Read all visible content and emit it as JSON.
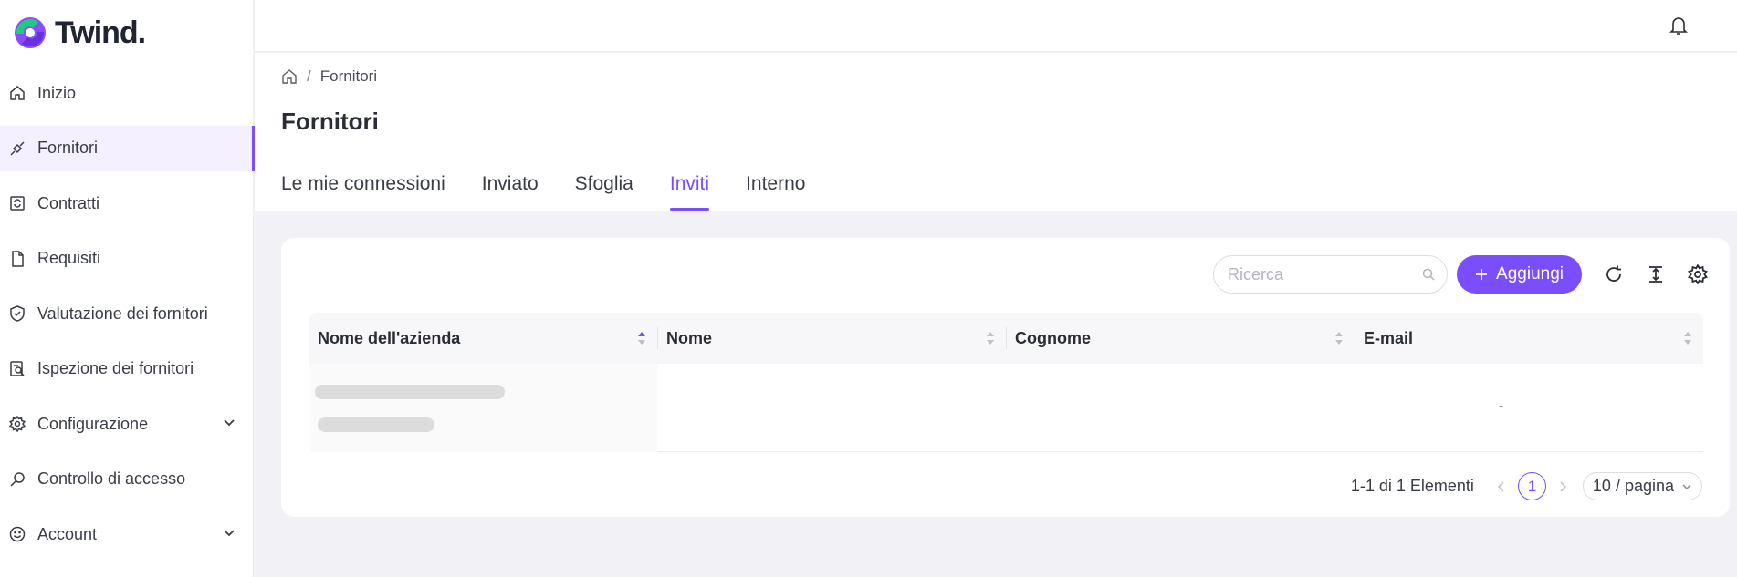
{
  "brand": {
    "name": "Twind."
  },
  "sidebar": {
    "items": [
      {
        "label": "Inizio",
        "icon": "home-icon"
      },
      {
        "label": "Fornitori",
        "icon": "link-icon",
        "active": true
      },
      {
        "label": "Contratti",
        "icon": "contract-icon"
      },
      {
        "label": "Requisiti",
        "icon": "document-icon"
      },
      {
        "label": "Valutazione dei fornitori",
        "icon": "shield-check-icon"
      },
      {
        "label": "Ispezione dei fornitori",
        "icon": "inspection-icon"
      },
      {
        "label": "Configurazione",
        "icon": "gear-icon",
        "expandable": true
      },
      {
        "label": "Controllo di accesso",
        "icon": "key-icon"
      },
      {
        "label": "Account",
        "icon": "smiley-icon",
        "expandable": true
      }
    ]
  },
  "breadcrumb": {
    "current": "Fornitori"
  },
  "page": {
    "title": "Fornitori"
  },
  "tabs": [
    {
      "label": "Le mie connessioni"
    },
    {
      "label": "Inviato"
    },
    {
      "label": "Sfoglia"
    },
    {
      "label": "Inviti",
      "active": true
    },
    {
      "label": "Interno"
    }
  ],
  "toolbar": {
    "search_placeholder": "Ricerca",
    "add_label": "Aggiungi"
  },
  "table": {
    "columns": [
      "Nome dell'azienda",
      "Nome",
      "Cognome",
      "E-mail"
    ],
    "rows": [
      {
        "email": "-"
      }
    ]
  },
  "pagination": {
    "total": "1-1 di 1 Elementi",
    "current_page": "1",
    "page_size": "10 / pagina"
  },
  "colors": {
    "accent": "#7a4dff",
    "background": "#f2f2f6"
  }
}
